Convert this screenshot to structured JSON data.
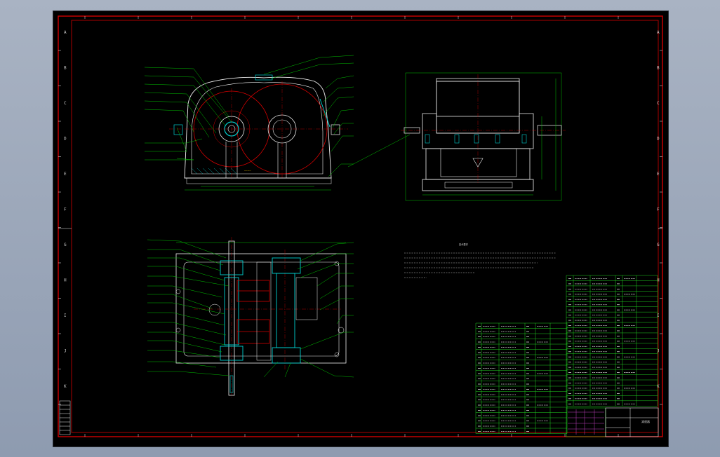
{
  "drawing": {
    "zones_left": [
      "A",
      "B",
      "C",
      "D",
      "E",
      "F",
      "G",
      "H",
      "I",
      "J",
      "K"
    ],
    "zones_right": [
      "A",
      "B",
      "C",
      "D",
      "E",
      "F",
      "G",
      "H",
      "I",
      "J",
      "K"
    ],
    "notes_title": "技术要求",
    "title_block_text": "减速器",
    "colors": {
      "frame": "#d10000",
      "geometry": "#f2f2f2",
      "leader": "#00c000",
      "section": "#00d0d0",
      "gear": "#d20000",
      "table": "#20d020",
      "text": "#cfcfcf"
    }
  }
}
